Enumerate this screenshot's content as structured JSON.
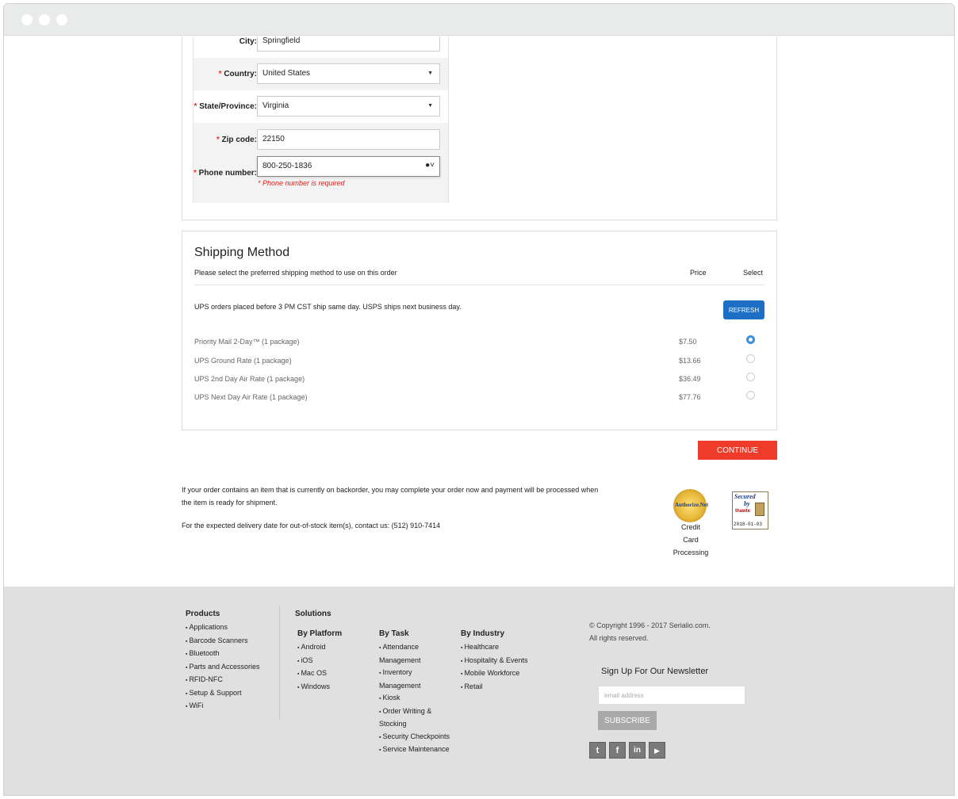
{
  "window": {
    "title": ""
  },
  "address_form": {
    "city": {
      "label": "City:",
      "value": "Springfield"
    },
    "country": {
      "label": "Country:",
      "value": "United States"
    },
    "state": {
      "label": "State/Province:",
      "value": "Virginia"
    },
    "zip": {
      "label": "Zip code:",
      "value": "22150"
    },
    "phone": {
      "label": "Phone number:",
      "value": "800-250-1836",
      "error": "* Phone number is required"
    },
    "required_mark": "*"
  },
  "shipping": {
    "title": "Shipping Method",
    "subtitle": "Please select the preferred shipping method to use on this order",
    "col_price": "Price",
    "col_select": "Select",
    "note": "UPS orders placed before 3 PM CST ship same day. USPS ships next business day.",
    "refresh_label": "REFRESH",
    "options": [
      {
        "name": "Priority Mail 2-Day™ (1 package)",
        "price": "$7.50",
        "selected": true
      },
      {
        "name": "UPS Ground Rate (1 package)",
        "price": "$13.66",
        "selected": false
      },
      {
        "name": "UPS 2nd Day Air Rate (1 package)",
        "price": "$36.49",
        "selected": false
      },
      {
        "name": "UPS Next Day Air Rate (1 package)",
        "price": "$77.76",
        "selected": false
      }
    ]
  },
  "continue_label": "CONTINUE",
  "info": {
    "backorder": "If your order contains an item that is currently on backorder, you may complete your order now and payment will be processed when the item is ready for shipment.",
    "expected": "For the expected delivery date for out-of-stock item(s), contact us: (512) 910-7414"
  },
  "badges": {
    "authorize_text": "Authorize.Net",
    "ccp": [
      "Credit",
      "Card",
      "Processing"
    ],
    "thawte_line1": "Secured",
    "thawte_line2": "by",
    "thawte_brand": "thawte",
    "thawte_date": "2018-01-03"
  },
  "footer": {
    "products_heading": "Products",
    "products": [
      "Applications",
      "Barcode Scanners",
      "Bluetooth",
      "Parts and Accessories",
      "RFID-NFC",
      "Setup & Support",
      "WiFi"
    ],
    "solutions_heading": "Solutions",
    "by_platform_heading": "By Platform",
    "by_platform": [
      "Android",
      "iOS",
      "Mac OS",
      "Windows"
    ],
    "by_task_heading": "By Task",
    "by_task": [
      "Attendance Management",
      "Inventory Management",
      "Kiosk",
      "Order Writing & Stocking",
      "Security Checkpoints",
      "Service Maintenance"
    ],
    "by_industry_heading": "By Industry",
    "by_industry": [
      "Healthcare",
      "Hospitality & Events",
      "Mobile Workforce",
      "Retail"
    ],
    "copyright_line1": "© Copyright 1996 - 2017 Serialio.com.",
    "copyright_line2": "All rights reserved.",
    "newsletter_title": "Sign Up For Our Newsletter",
    "newsletter_placeholder": "email address",
    "subscribe_label": "SUBSCRIBE",
    "social": [
      {
        "icon": "twitter-icon",
        "glyph": "t"
      },
      {
        "icon": "facebook-icon",
        "glyph": "f"
      },
      {
        "icon": "linkedin-icon",
        "glyph": "in"
      },
      {
        "icon": "youtube-icon",
        "glyph": "▶"
      }
    ]
  },
  "colors": {
    "accent_blue": "#1c6fc4",
    "continue_red": "#ee3b2a",
    "error_red": "#e0201c",
    "footer_bg": "#e0e0e0"
  }
}
